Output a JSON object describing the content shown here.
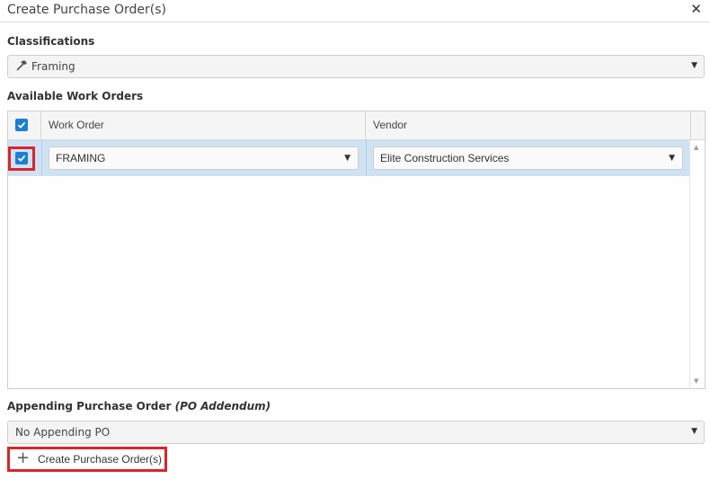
{
  "dialog": {
    "title": "Create Purchase Order(s)",
    "close_glyph": "✕"
  },
  "classifications": {
    "label": "Classifications",
    "selected": "Framing",
    "icon": "hammer-icon"
  },
  "work_orders": {
    "label": "Available Work Orders",
    "columns": [
      "Work Order",
      "Vendor"
    ],
    "select_all_checked": true,
    "rows": [
      {
        "checked": true,
        "work_order": "FRAMING",
        "vendor": "Elite Construction Services"
      }
    ]
  },
  "appending": {
    "label": "Appending Purchase Order",
    "label_italic": "(PO Addendum)",
    "selected": "No Appending PO"
  },
  "actions": {
    "create_label": "Create Purchase Order(s)",
    "create_icon": "plus-icon"
  },
  "colors": {
    "accent": "#1e7fd0",
    "row_selected": "#cfe2f3",
    "highlight": "#d6262e"
  }
}
